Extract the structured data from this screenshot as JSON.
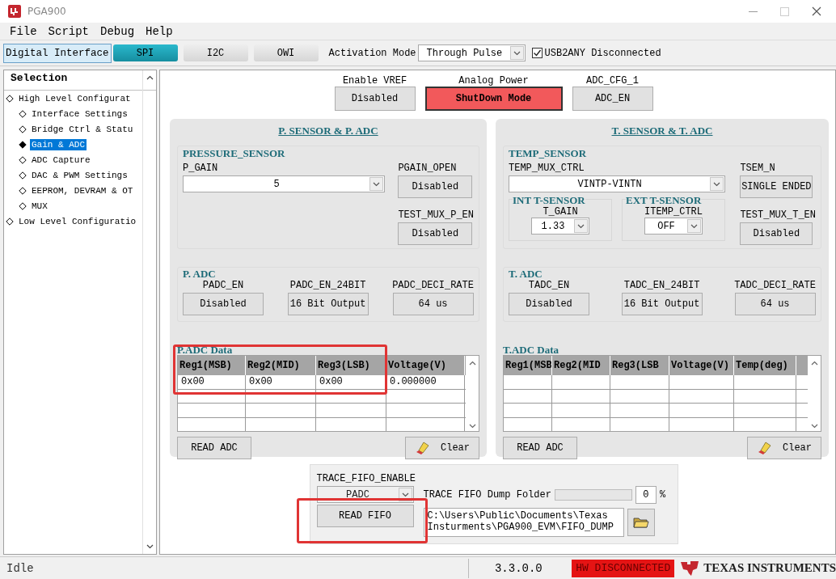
{
  "window": {
    "title": "PGA900"
  },
  "menu": [
    "File",
    "Script",
    "Debug",
    "Help"
  ],
  "toolbar": {
    "label": "Digital Interface",
    "tabs": [
      {
        "label": "SPI",
        "selected": true
      },
      {
        "label": "I2C",
        "selected": false
      },
      {
        "label": "OWI",
        "selected": false
      }
    ],
    "activation_mode": {
      "label": "Activation Mode",
      "value": "Through Pulse"
    },
    "usb2any": {
      "label": "USB2ANY Disconnected",
      "checked": true
    }
  },
  "sidebar": {
    "title": "Selection",
    "items": [
      {
        "label": "High Level Configurat",
        "selected": false,
        "children": [
          {
            "label": "Interface Settings",
            "selected": false
          },
          {
            "label": "Bridge Ctrl & Statu",
            "selected": false
          },
          {
            "label": "Gain & ADC",
            "selected": true
          },
          {
            "label": "ADC Capture",
            "selected": false
          },
          {
            "label": "DAC & PWM Settings",
            "selected": false
          },
          {
            "label": "EEPROM, DEVRAM & OT",
            "selected": false
          },
          {
            "label": "MUX",
            "selected": false
          }
        ]
      },
      {
        "label": "Low Level Configuratio",
        "selected": false
      }
    ]
  },
  "top_controls": [
    {
      "label": "Enable VREF",
      "value": "Disabled",
      "active": false
    },
    {
      "label": "Analog Power",
      "value": "ShutDown Mode",
      "active": true
    },
    {
      "label": "ADC_CFG_1",
      "value": "ADC_EN",
      "active": false
    }
  ],
  "panels": [
    {
      "title": "P. SENSOR & P. ADC",
      "sensor": {
        "kind": "pressure",
        "title": "PRESSURE_SENSOR",
        "gain": {
          "label": "P_GAIN",
          "value": "5"
        },
        "side_buttons": [
          {
            "label": "PGAIN_OPEN",
            "value": "Disabled"
          },
          {
            "label": "TEST_MUX_P_EN",
            "value": "Disabled"
          }
        ]
      },
      "adc": {
        "title": "P. ADC",
        "fields": [
          {
            "label": "PADC_EN",
            "value": "Disabled"
          },
          {
            "label": "PADC_EN_24BIT",
            "value": "16 Bit Output"
          },
          {
            "label": "PADC_DECI_RATE",
            "value": "64 us"
          }
        ]
      },
      "data": {
        "title": "P.ADC Data",
        "highlighted": true,
        "columns": [
          "Reg1(MSB)",
          "Reg2(MID)",
          "Reg3(LSB)",
          "Voltage(V)"
        ],
        "rows": [
          [
            "0x00",
            "0x00",
            "0x00",
            "0.000000"
          ]
        ]
      },
      "read_button": "READ ADC",
      "clear_button": "Clear"
    },
    {
      "title": "T. SENSOR & T. ADC",
      "sensor": {
        "kind": "temperature",
        "title": "TEMP_SENSOR",
        "gain": {
          "label": "TEMP_MUX_CTRL",
          "value": "VINTP-VINTN"
        },
        "side_buttons": [
          {
            "label": "TSEM_N",
            "value": "SINGLE ENDED"
          },
          {
            "label": "TEST_MUX_T_EN",
            "value": "Disabled"
          }
        ],
        "subgroups": [
          {
            "title": "INT T-SENSOR",
            "label": "T_GAIN",
            "value": "1.33"
          },
          {
            "title": "EXT T-SENSOR",
            "label": "ITEMP_CTRL",
            "value": "OFF"
          }
        ]
      },
      "adc": {
        "title": "T. ADC",
        "fields": [
          {
            "label": "TADC_EN",
            "value": "Disabled"
          },
          {
            "label": "TADC_EN_24BIT",
            "value": "16 Bit Output"
          },
          {
            "label": "TADC_DECI_RATE",
            "value": "64 us"
          }
        ]
      },
      "data": {
        "title": "T.ADC Data",
        "highlighted": false,
        "columns": [
          "Reg1(MSB",
          "Reg2(MID",
          "Reg3(LSB",
          "Voltage(V)",
          "Temp(deg)"
        ]
      },
      "read_button": "READ ADC",
      "clear_button": "Clear"
    }
  ],
  "fifo": {
    "enable": {
      "label": "TRACE_FIFO_ENABLE",
      "value": "PADC",
      "disabled": true
    },
    "read_button": "READ FIFO",
    "highlighted": true,
    "folder_label": "TRACE FIFO Dump Folder",
    "progress": {
      "level": 0
    },
    "percent_value": "0",
    "percent_unit": "%",
    "path": "C:\\Users\\Public\\Documents\\Texas Insturments\\PGA900_EVM\\FIFO_DUMP"
  },
  "status_bar": {
    "state": "Idle",
    "version": "3.3.0.0",
    "connection": "HW DISCONNECTED",
    "logo": "TEXAS INSTRUMENTS"
  }
}
